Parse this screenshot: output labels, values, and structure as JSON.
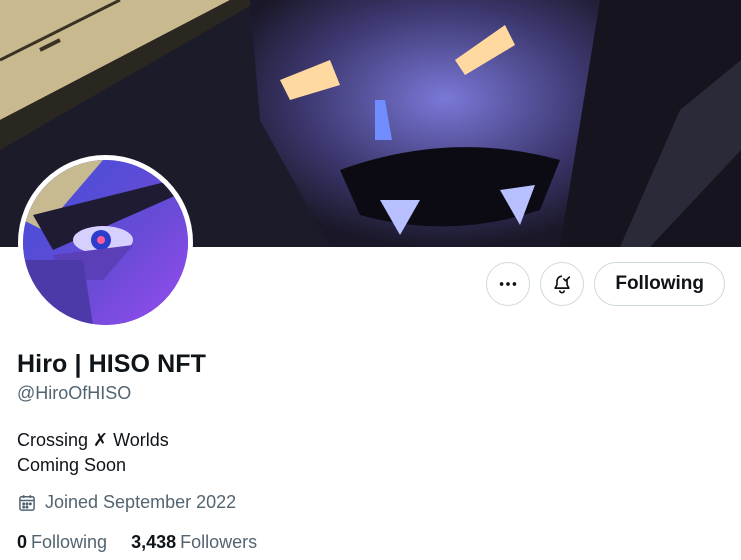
{
  "profile": {
    "name": "Hiro | HISO NFT",
    "handle": "@HiroOfHISO",
    "bio_line1": "Crossing ✗ Worlds",
    "bio_line2": "Coming Soon",
    "joined": "Joined September 2022"
  },
  "actions": {
    "more_icon": "more-icon",
    "notify_icon": "bell-subscribed-icon",
    "following_label": "Following"
  },
  "stats": {
    "following_count": "0",
    "following_label": "Following",
    "followers_count": "3,438",
    "followers_label": "Followers"
  },
  "colors": {
    "text_primary": "#0f1419",
    "text_secondary": "#536471",
    "border": "#cfd9de",
    "banner_bg": "#1e1b2e",
    "avatar_accent": "#8a4dff"
  }
}
